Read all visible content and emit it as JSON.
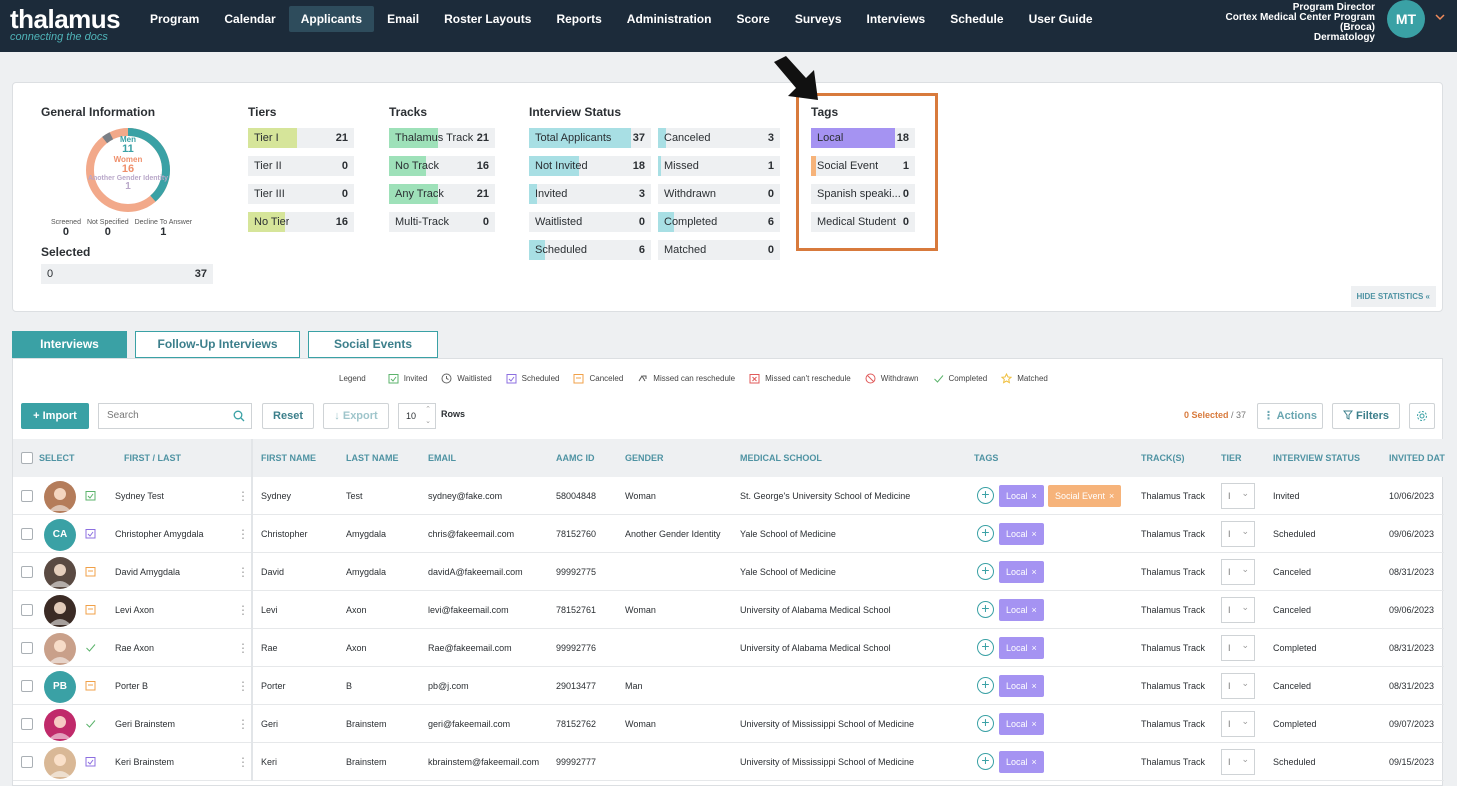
{
  "nav": {
    "brand": "thalamus",
    "tagline": "connecting the docs",
    "items": [
      "Program",
      "Calendar",
      "Applicants",
      "Email",
      "Roster Layouts",
      "Reports",
      "Administration",
      "Score",
      "Surveys",
      "Interviews",
      "Schedule",
      "User Guide"
    ],
    "active": "Applicants",
    "user": {
      "role": "Program Director",
      "program": "Cortex Medical Center Program",
      "program2": "(Broca)",
      "specialty": "Dermatology",
      "initials": "MT"
    }
  },
  "stats": {
    "general": {
      "title": "General Information",
      "donut": {
        "men_label": "Men",
        "men": "11",
        "women_label": "Women",
        "women": "16",
        "other_label": "Another Gender Identity",
        "other": "1"
      },
      "mini": [
        {
          "label": "Screened",
          "value": "0"
        },
        {
          "label": "Not Specified",
          "value": "0"
        },
        {
          "label": "Decline To Answer",
          "value": "1"
        }
      ],
      "selected_title": "Selected",
      "selected": {
        "value": "0",
        "total": "37"
      }
    },
    "tiers": {
      "title": "Tiers",
      "rows": [
        {
          "label": "Tier I",
          "value": "21",
          "fill": 0.57
        },
        {
          "label": "Tier II",
          "value": "0",
          "fill": 0
        },
        {
          "label": "Tier III",
          "value": "0",
          "fill": 0
        },
        {
          "label": "No Tier",
          "value": "16",
          "fill": 0.43
        }
      ]
    },
    "tracks": {
      "title": "Tracks",
      "rows": [
        {
          "label": "Thalamus Track",
          "value": "21",
          "fill": 0.57
        },
        {
          "label": "No Track",
          "value": "16",
          "fill": 0.43
        },
        {
          "label": "Any Track",
          "value": "21",
          "fill": 0.57
        },
        {
          "label": "Multi-Track",
          "value": "0",
          "fill": 0
        }
      ]
    },
    "interview_status": {
      "title": "Interview Status",
      "left": [
        {
          "label": "Total Applicants",
          "value": "37",
          "fill": 1.0
        },
        {
          "label": "Not Invited",
          "value": "18",
          "fill": 0.49
        },
        {
          "label": "Invited",
          "value": "3",
          "fill": 0.08
        },
        {
          "label": "Waitlisted",
          "value": "0",
          "fill": 0
        },
        {
          "label": "Scheduled",
          "value": "6",
          "fill": 0.16
        }
      ],
      "right": [
        {
          "label": "Canceled",
          "value": "3",
          "fill": 0.08
        },
        {
          "label": "Missed",
          "value": "1",
          "fill": 0.03
        },
        {
          "label": "Withdrawn",
          "value": "0",
          "fill": 0
        },
        {
          "label": "Completed",
          "value": "6",
          "fill": 0.16
        },
        {
          "label": "Matched",
          "value": "0",
          "fill": 0
        }
      ]
    },
    "tags": {
      "title": "Tags",
      "rows": [
        {
          "label": "Local",
          "value": "18",
          "fill": 1.0,
          "color": "#a593f2"
        },
        {
          "label": "Social Event",
          "value": "1",
          "fill": 0.06,
          "color": "#f6b37a"
        },
        {
          "label": "Spanish speaki...",
          "value": "0",
          "fill": 0,
          "color": "#a593f2"
        },
        {
          "label": "Medical Student",
          "value": "0",
          "fill": 0,
          "color": "#a593f2"
        }
      ]
    },
    "hide_label": "HIDE STATISTICS «"
  },
  "tabs": [
    {
      "label": "Interviews",
      "active": true
    },
    {
      "label": "Follow-Up Interviews"
    },
    {
      "label": "Social Events"
    }
  ],
  "legend": {
    "title": "Legend",
    "items": [
      "Invited",
      "Waitlisted",
      "Scheduled",
      "Canceled",
      "Missed can reschedule",
      "Missed can't reschedule",
      "Withdrawn",
      "Completed",
      "Matched"
    ]
  },
  "toolbar": {
    "import": "+ Import",
    "search_placeholder": "Search",
    "reset": "Reset",
    "export": "↓ Export",
    "rows_value": "10",
    "rows_label": "Rows",
    "selected_count": "0 Selected",
    "selected_total": "/ 37",
    "actions": "⋮ Actions",
    "filters": "Filters"
  },
  "columns": {
    "select": "SELECT",
    "first_last": "FIRST / LAST",
    "first": "FIRST NAME",
    "last": "LAST NAME",
    "email": "EMAIL",
    "aamc": "AAMC ID",
    "gender": "GENDER",
    "school": "MEDICAL SCHOOL",
    "tags": "TAGS",
    "tracks": "TRACK(S)",
    "tier": "TIER",
    "status": "INTERVIEW STATUS",
    "invited": "INVITED DAT"
  },
  "rows": [
    {
      "full": "Sydney Test",
      "first": "Sydney",
      "last": "Test",
      "email": "sydney@fake.com",
      "aamc": "58004848",
      "gender": "Woman",
      "school": "St. George's University School of Medicine",
      "tags": [
        "Local",
        "Social Event"
      ],
      "track": "Thalamus Track",
      "tier": "I",
      "status": "Invited",
      "date": "10/06/2023",
      "avatar": "photo",
      "status_icon": "invited-icon"
    },
    {
      "full": "Christopher Amygdala",
      "first": "Christopher",
      "last": "Amygdala",
      "email": "chris@fakeemail.com",
      "aamc": "78152760",
      "gender": "Another Gender Identity",
      "school": "Yale School of Medicine",
      "tags": [
        "Local"
      ],
      "track": "Thalamus Track",
      "tier": "I",
      "status": "Scheduled",
      "date": "09/06/2023",
      "avatar": "CA",
      "status_icon": "scheduled-icon"
    },
    {
      "full": "David Amygdala",
      "first": "David",
      "last": "Amygdala",
      "email": "davidA@fakeemail.com",
      "aamc": "99992775",
      "gender": "",
      "school": "Yale School of Medicine",
      "tags": [
        "Local"
      ],
      "track": "Thalamus Track",
      "tier": "I",
      "status": "Canceled",
      "date": "08/31/2023",
      "avatar": "photo",
      "status_icon": "canceled-icon"
    },
    {
      "full": "Levi Axon",
      "first": "Levi",
      "last": "Axon",
      "email": "levi@fakeemail.com",
      "aamc": "78152761",
      "gender": "Woman",
      "school": "University of Alabama Medical School",
      "tags": [
        "Local"
      ],
      "track": "Thalamus Track",
      "tier": "I",
      "status": "Canceled",
      "date": "09/06/2023",
      "avatar": "photo",
      "status_icon": "canceled-icon"
    },
    {
      "full": "Rae Axon",
      "first": "Rae",
      "last": "Axon",
      "email": "Rae@fakeemail.com",
      "aamc": "99992776",
      "gender": "",
      "school": "University of Alabama Medical School",
      "tags": [
        "Local"
      ],
      "track": "Thalamus Track",
      "tier": "I",
      "status": "Completed",
      "date": "08/31/2023",
      "avatar": "photo",
      "status_icon": "completed-icon"
    },
    {
      "full": "Porter B",
      "first": "Porter",
      "last": "B",
      "email": "pb@j.com",
      "aamc": "29013477",
      "gender": "Man",
      "school": "",
      "tags": [
        "Local"
      ],
      "track": "Thalamus Track",
      "tier": "I",
      "status": "Canceled",
      "date": "08/31/2023",
      "avatar": "PB",
      "status_icon": "canceled-icon"
    },
    {
      "full": "Geri Brainstem",
      "first": "Geri",
      "last": "Brainstem",
      "email": "geri@fakeemail.com",
      "aamc": "78152762",
      "gender": "Woman",
      "school": "University of Mississippi School of Medicine",
      "tags": [
        "Local"
      ],
      "track": "Thalamus Track",
      "tier": "I",
      "status": "Completed",
      "date": "09/07/2023",
      "avatar": "photo",
      "status_icon": "completed-icon"
    },
    {
      "full": "Keri Brainstem",
      "first": "Keri",
      "last": "Brainstem",
      "email": "kbrainstem@fakeemail.com",
      "aamc": "99992777",
      "gender": "",
      "school": "University of Mississippi School of Medicine",
      "tags": [
        "Local"
      ],
      "track": "Thalamus Track",
      "tier": "I",
      "status": "Scheduled",
      "date": "09/15/2023",
      "avatar": "photo",
      "status_icon": "scheduled-icon"
    }
  ]
}
